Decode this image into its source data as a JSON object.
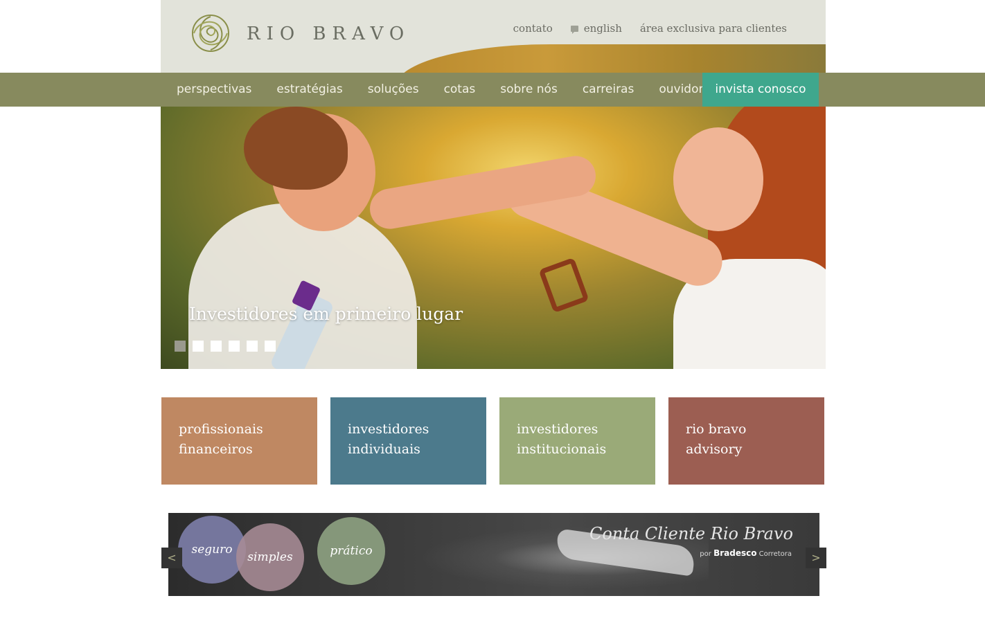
{
  "brand": {
    "name": "RIO BRAVO",
    "logo_icon": "spiral-logo-icon"
  },
  "top_links": [
    {
      "label": "contato"
    },
    {
      "label": "english",
      "icon": "speech-bubble-icon"
    },
    {
      "label": "área exclusiva para clientes"
    }
  ],
  "nav": {
    "items": [
      "perspectivas",
      "estratégias",
      "soluções",
      "cotas",
      "sobre nós",
      "carreiras",
      "ouvidoria"
    ],
    "cta": "invista conosco"
  },
  "hero": {
    "caption": "Investidores em primeiro lugar",
    "slide_count": 6,
    "active_slide": 1
  },
  "tiles": [
    {
      "line1": "profissionais",
      "line2": "financeiros",
      "color": "#bf8862"
    },
    {
      "line1": "investidores",
      "line2": "individuais",
      "color": "#4c7a8c"
    },
    {
      "line1": "investidores",
      "line2": "institucionais",
      "color": "#9aaa78"
    },
    {
      "line1": "rio bravo",
      "line2": "advisory",
      "color": "#9c5e52"
    }
  ],
  "banner": {
    "circles": [
      "seguro",
      "simples",
      "prático"
    ],
    "title": "Conta Cliente Rio Bravo",
    "sub_prefix": "por",
    "sub_brand": "Bradesco",
    "sub_suffix": "Corretora",
    "prev": "<",
    "next": ">"
  },
  "colors": {
    "header_bg": "#e2e3da",
    "nav_bg": "#878a5e",
    "cta_bg": "#3fa78d",
    "text_grey": "#6a6b63"
  }
}
